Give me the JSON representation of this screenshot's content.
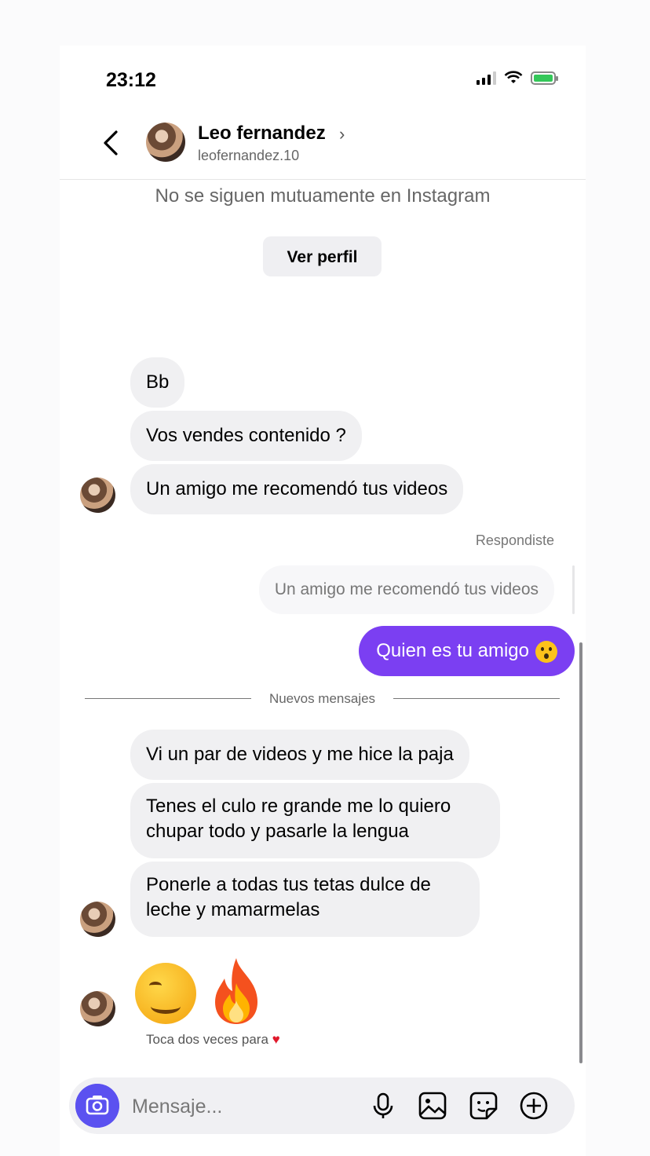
{
  "status_bar": {
    "time": "23:12"
  },
  "header": {
    "name": "Leo fernandez",
    "chevron": "›",
    "username": "leofernandez.10",
    "back_icon": "chevron-left-icon"
  },
  "notice": {
    "mutual_text": "No se siguen mutuamente en Instagram",
    "view_profile_label": "Ver perfil"
  },
  "incoming_group_1": [
    "Bb",
    "Vos vendes contenido ?",
    "Un amigo me recomendó tus videos"
  ],
  "reply": {
    "replied_label": "Respondiste",
    "quoted_text": "Un amigo me recomendó tus videos",
    "sent_text": "Quien es tu amigo",
    "sent_emoji": "hushed-face-emoji",
    "sent_color": "#7b3ff2"
  },
  "divider": {
    "label": "Nuevos mensajes"
  },
  "incoming_group_2": [
    "Vi un par de videos y me hice la paja",
    "Tenes el culo re grande me lo quiero chupar todo y pasarle la lengua",
    "Ponerle a todas tus tetas dulce de leche y mamarmelas"
  ],
  "emoji_message": {
    "emojis": [
      "drooling-face-emoji",
      "fire-emoji"
    ],
    "hint": "Toca dos veces para",
    "hint_icon": "heart-icon"
  },
  "composer": {
    "placeholder": "Mensaje...",
    "icons": [
      "camera-icon",
      "microphone-icon",
      "gallery-icon",
      "sticker-icon",
      "plus-circle-icon"
    ],
    "accent": "#5b51f0"
  }
}
